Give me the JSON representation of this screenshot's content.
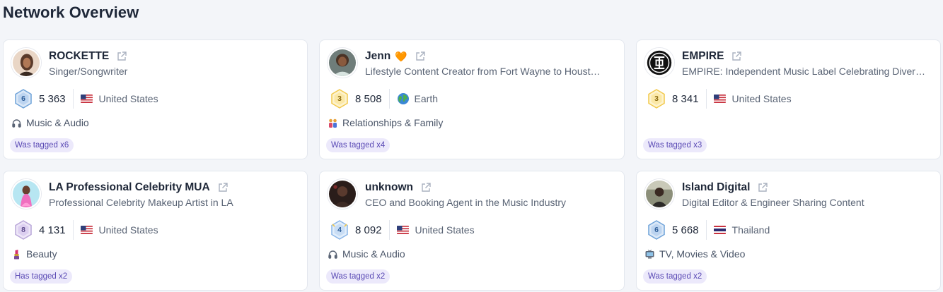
{
  "page": {
    "title": "Network Overview"
  },
  "cards": [
    {
      "name": "ROCKETTE",
      "description": "Singer/Songwriter",
      "level": "6",
      "level_color": "#6fa3d9",
      "followers": "5 363",
      "location": "United States",
      "location_icon": "us-flag-icon",
      "category": "Music & Audio",
      "category_icon": "headphones-icon",
      "tag": "Was tagged x6"
    },
    {
      "name": "Jenn",
      "name_suffix": "🧡",
      "description": "Lifestyle Content Creator from Fort Wayne to Houst…",
      "level": "3",
      "level_color": "#f2c94c",
      "followers": "8 508",
      "location": "Earth",
      "location_icon": "globe-icon",
      "category": "Relationships & Family",
      "category_icon": "family-icon",
      "tag": "Was tagged x4"
    },
    {
      "name": "EMPIRE",
      "description": "EMPIRE: Independent Music Label Celebrating Diver…",
      "level": "3",
      "level_color": "#f2c94c",
      "followers": "8 341",
      "location": "United States",
      "location_icon": "us-flag-icon",
      "category": "",
      "category_icon": "",
      "tag": "Was tagged x3"
    },
    {
      "name": "LA Professional Celebrity MUA",
      "description": "Professional Celebrity Makeup Artist in LA",
      "level": "8",
      "level_color": "#b9a7d9",
      "followers": "4 131",
      "location": "United States",
      "location_icon": "us-flag-icon",
      "category": "Beauty",
      "category_icon": "lipstick-icon",
      "tag": "Has tagged x2"
    },
    {
      "name": "unknown",
      "description": "CEO and Booking Agent in the Music Industry",
      "level": "4",
      "level_color": "#8ab6e8",
      "followers": "8 092",
      "location": "United States",
      "location_icon": "us-flag-icon",
      "category": "Music & Audio",
      "category_icon": "headphones-icon",
      "tag": "Was tagged x2"
    },
    {
      "name": "Island Digital",
      "description": "Digital Editor & Engineer Sharing Content",
      "level": "6",
      "level_color": "#6fa3d9",
      "followers": "5 668",
      "location": "Thailand",
      "location_icon": "th-flag-icon",
      "category": "TV, Movies & Video",
      "category_icon": "tv-icon",
      "tag": "Was tagged x2"
    }
  ]
}
